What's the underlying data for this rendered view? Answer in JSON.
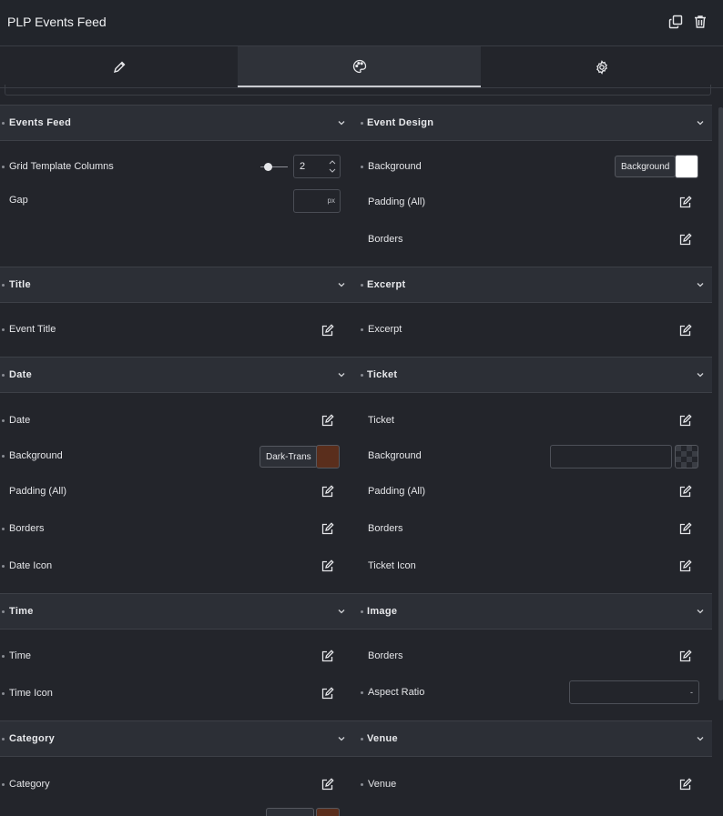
{
  "header": {
    "title": "PLP Events Feed",
    "icons": [
      "copy-icon",
      "trash-icon"
    ]
  },
  "tabs": [
    {
      "name": "content",
      "icon": "pencil-icon",
      "active": false
    },
    {
      "name": "style",
      "icon": "palette-icon",
      "active": true
    },
    {
      "name": "advanced",
      "icon": "gear-icon",
      "active": false
    }
  ],
  "sections": {
    "events_feed": {
      "title": "Events Feed",
      "grid_template_columns": {
        "label": "Grid Template Columns",
        "value": "2"
      },
      "gap": {
        "label": "Gap",
        "unit": "px"
      }
    },
    "event_design": {
      "title": "Event Design",
      "background": {
        "label": "Background",
        "button": "Background",
        "color": "#ffffff"
      },
      "padding": "Padding (All)",
      "borders": "Borders"
    },
    "title": {
      "title": "Title",
      "event_title": "Event Title"
    },
    "excerpt": {
      "title": "Excerpt",
      "excerpt": "Excerpt"
    },
    "date": {
      "title": "Date",
      "date": "Date",
      "background": {
        "label": "Background",
        "button": "Dark-Trans",
        "color": "#5a2e1c"
      },
      "padding": "Padding (All)",
      "borders": "Borders",
      "icon": "Date Icon"
    },
    "ticket": {
      "title": "Ticket",
      "ticket": "Ticket",
      "background": {
        "label": "Background"
      },
      "padding": "Padding (All)",
      "borders": "Borders",
      "icon": "Ticket Icon"
    },
    "time": {
      "title": "Time",
      "time": "Time",
      "icon": "Time Icon"
    },
    "image": {
      "title": "Image",
      "borders": "Borders",
      "aspect_ratio": {
        "label": "Aspect Ratio",
        "caret": "-"
      }
    },
    "category": {
      "title": "Category",
      "category": "Category",
      "swatch_color": "#5a2e1c"
    },
    "venue": {
      "title": "Venue",
      "venue": "Venue"
    }
  }
}
